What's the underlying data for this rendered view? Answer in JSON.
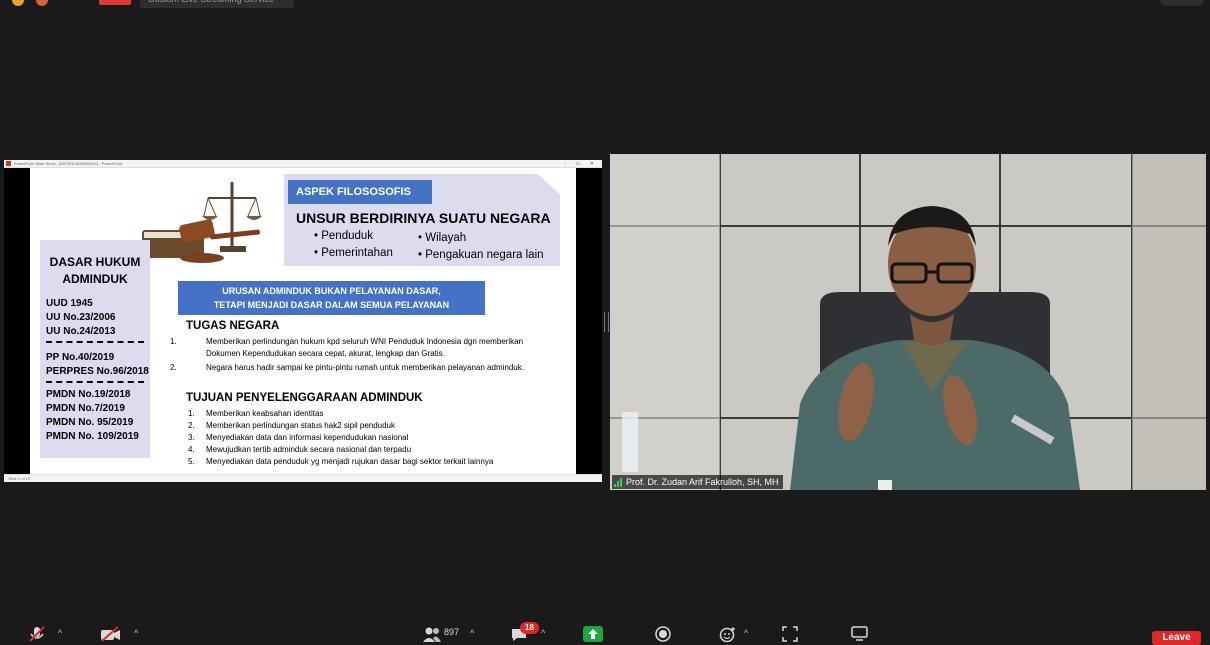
{
  "top_bar": {
    "pill_text": "Custom Live Streaming Service"
  },
  "ppt_window": {
    "title": "PowerPoint Slide Show - [DIRJEN ADMINDUK] - PowerPoint",
    "status": "Slide 2 of 10"
  },
  "slide": {
    "aspek_label": "ASPEK FILOSOSOFIS",
    "unsur_title": "UNSUR BERDIRINYA SUATU NEGARA",
    "unsur_items": [
      "Penduduk",
      "Wilayah",
      "Pemerintahan",
      "Pengakuan negara lain"
    ],
    "dasar_title_1": "DASAR HUKUM",
    "dasar_title_2": "ADMINDUK",
    "dasar_items": [
      "UUD 1945",
      "UU No.23/2006",
      "UU No.24/2013",
      "PP No.40/2019",
      "PERPRES No.96/2018",
      "PMDN No.19/2018",
      "PMDN No.7/2019",
      "PMDN No. 95/2019",
      "PMDN No. 109/2019"
    ],
    "urusan_line1": "URUSAN ADMINDUK BUKAN PELAYANAN DASAR,",
    "urusan_line2": "TETAPI MENJADI DASAR DALAM SEMUA PELAYANAN",
    "tugas_title": "TUGAS NEGARA",
    "tugas_items": [
      "Memberikan perlindungan hukum kpd seluruh WNI Penduduk Indonesia dgn memberikan Dokumen Kependudukan secara cepat, akurat, lengkap dan Gratis.",
      "Negara harus hadir sampai ke pintu-pintu rumah untuk memberikan pelayanan adminduk."
    ],
    "tujuan_title": "TUJUAN PENYELENGGARAAN ADMINDUK",
    "tujuan_items": [
      "Memberikan keabsahan identitas",
      "Memberikan perlindungan status hak2 sipil penduduk",
      "Menyediakan data dan informasi kependudukan nasional",
      "Mewujudkan tertib adminduk secara nasional dan terpadu",
      "Menyediakan data penduduk yg menjadi rujukan dasar bagi sektor terkait lainnya"
    ],
    "numbers": [
      "1.",
      "2.",
      "3.",
      "4.",
      "5."
    ]
  },
  "video": {
    "participant_name": "Prof. Dr. Zudan Arif Fakrulloh, SH, MH"
  },
  "toolbar": {
    "participants_count": "897",
    "chat_badge": "18",
    "leave_label": "Leave",
    "caret": "^"
  },
  "colors": {
    "accent_blue": "#4472c4",
    "lavender": "#dcdcee",
    "leave_red": "#e02828",
    "share_green": "#1fa83a"
  }
}
